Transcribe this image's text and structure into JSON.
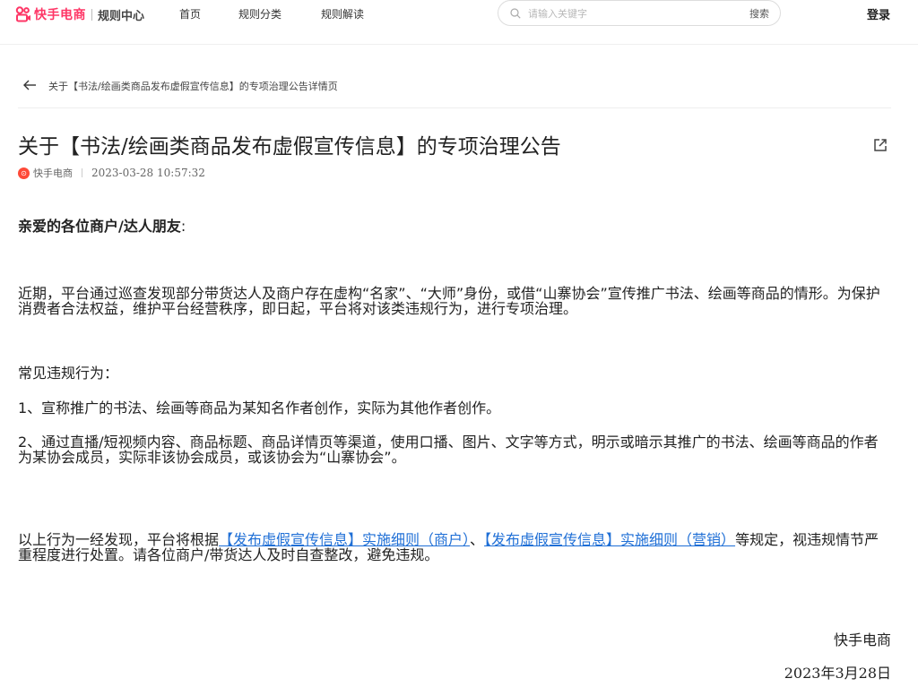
{
  "header": {
    "brand": "快手电商",
    "section": "规则中心",
    "nav": [
      {
        "label": "首页"
      },
      {
        "label": "规则分类"
      },
      {
        "label": "规则解读"
      }
    ],
    "search": {
      "placeholder": "请输入关键字",
      "button": "搜索"
    },
    "login": "登录"
  },
  "breadcrumb": "关于【书法/绘画类商品发布虚假宣传信息】的专项治理公告详情页",
  "article": {
    "title": "关于【书法/绘画类商品发布虚假宣传信息】的专项治理公告",
    "author": "快手电商",
    "publish_time": "2023-03-28 10:57:32",
    "greeting": "亲爱的各位商户/达人朋友",
    "greeting_colon": ":",
    "intro": "近期，平台通过巡查发现部分带货达人及商户存在虚构“名家”、“大师”身份，或借“山寨协会”宣传推广书法、绘画等商品的情形。为保护消费者合法权益，维护平台经营秩序，即日起，平台将对该类违规行为，进行专项治理。",
    "violations_heading": "常见违规行为：",
    "violation_1": "1、宣称推广的书法、绘画等商品为某知名作者创作，实际为其他作者创作。",
    "violation_2": "2、通过直播/短视频内容、商品标题、商品详情页等渠道，使用口播、图片、文字等方式，明示或暗示其推广的书法、绘画等商品的作者为某协会成员，实际非该协会成员，或该协会为“山寨协会”。",
    "closing": {
      "prefix": "以上行为一经发现，平台将根据",
      "link1": "【发布虚假宣传信息】实施细则（商户）",
      "middle": "、",
      "link2": "【发布虚假宣传信息】实施细则（营销）",
      "suffix": "等规定，视违规情节严重程度进行处置。请各位商户/带货达人及时自查整改，避免违规。"
    },
    "signature": "快手电商",
    "signature_date": "2023年3月28日"
  },
  "colors": {
    "brand": "#fe3666",
    "link": "#1f6fd6"
  }
}
